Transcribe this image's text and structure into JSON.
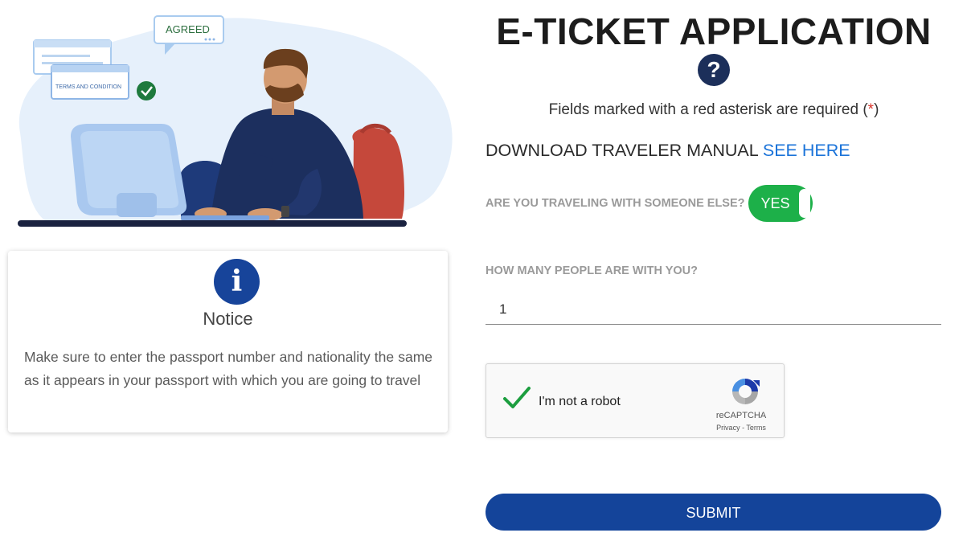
{
  "illustration": {
    "speech_bubble": "AGREED",
    "document_label": "TERMS AND CONDITION"
  },
  "notice": {
    "icon": "info-icon",
    "title": "Notice",
    "text": "Make sure to enter the passport number and nationality the same as it appears in your passport with which you are going to travel"
  },
  "form": {
    "title": "E-TICKET APPLICATION",
    "help_icon": "question-icon",
    "required_note": "Fields marked with a red asterisk are required (",
    "required_asterisk": "*",
    "required_close": ")",
    "download_label": "DOWNLOAD TRAVELER MANUAL",
    "download_link": "SEE HERE",
    "traveling_question": "ARE YOU TRAVELING WITH SOMEONE ELSE?",
    "traveling_toggle": "YES",
    "traveling_on": true,
    "people_question": "HOW MANY PEOPLE ARE WITH YOU?",
    "people_value": "1",
    "captcha": {
      "label": "I'm not a robot",
      "brand": "reCAPTCHA",
      "privacy": "Privacy",
      "separator": " - ",
      "terms": "Terms",
      "checked": true
    },
    "submit_label": "SUBMIT"
  },
  "colors": {
    "primary": "#14449a",
    "toggle_on": "#1db049",
    "link": "#1a73d9",
    "asterisk": "#d9342b"
  }
}
